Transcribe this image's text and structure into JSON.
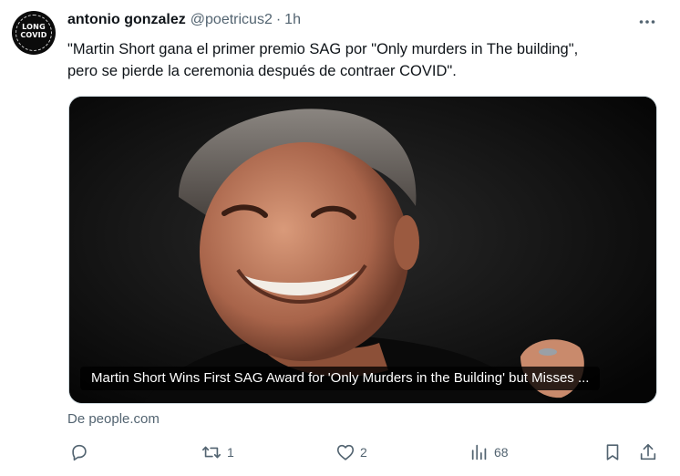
{
  "tweet": {
    "author_name": "antonio gonzalez",
    "author_handle": "@poetricus2",
    "separator": "·",
    "time": "1h",
    "more_label": "···",
    "avatar_text": [
      "LONG",
      "COVID"
    ],
    "text_lines": [
      "\"Martin Short gana el primer premio SAG por \"Only murders in The building\",",
      "pero se pierde la ceremonia después de contraer COVID\"."
    ],
    "card": {
      "title": "Martin Short Wins First SAG Award for 'Only Murders in the Building' but Misses ...",
      "source": "De people.com"
    },
    "actions": {
      "reply_count": "",
      "retweet_count": "1",
      "like_count": "2",
      "views_count": "68"
    }
  },
  "colors": {
    "text": "#0f1419",
    "secondary": "#536471",
    "card_bg": "#0d0d0d",
    "border": "#cfd9de"
  },
  "icons": [
    "more-icon",
    "reply-icon",
    "retweet-icon",
    "like-icon",
    "views-icon",
    "bookmark-icon",
    "share-icon"
  ]
}
